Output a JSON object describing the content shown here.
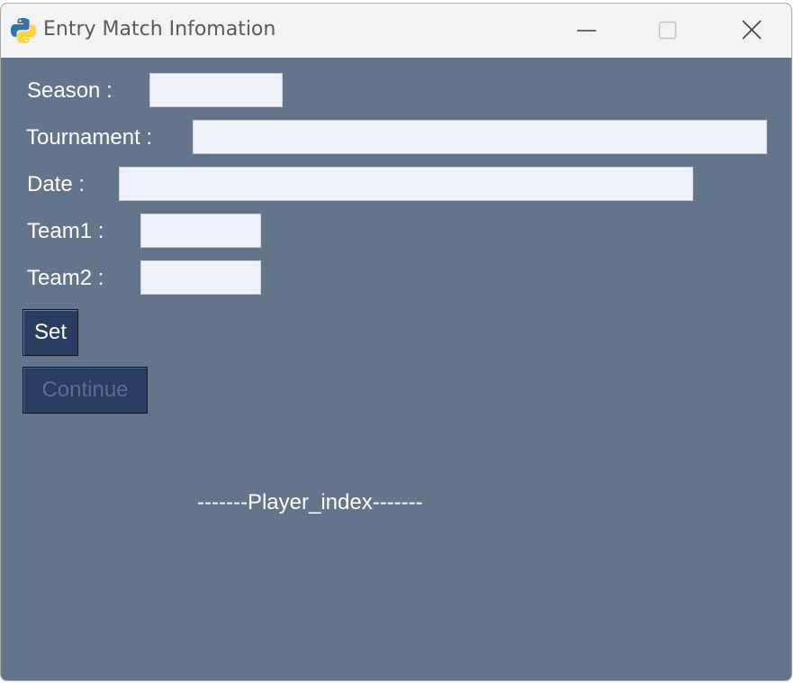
{
  "window": {
    "title": "Entry Match Infomation",
    "controls": {
      "minimize": "minimize-icon",
      "maximize": "maximize-icon",
      "close": "close-icon"
    }
  },
  "form": {
    "season_label": "Season :",
    "season_value": "",
    "tournament_label": "Tournament :",
    "tournament_value": "",
    "date_label": "Date :",
    "date_value": "",
    "team1_label": "Team1 :",
    "team1_value": "",
    "team2_label": "Team2 :",
    "team2_value": ""
  },
  "buttons": {
    "set_label": "Set",
    "continue_label": "Continue"
  },
  "player_index_text": "-------Player_index-------",
  "colors": {
    "background": "#64758b",
    "titlebar": "#f3f3f3",
    "entry_bg": "#eff2f8",
    "button_bg": "#293c61",
    "button_text": "#ffffff",
    "button_disabled_text": "#5c6e8c"
  }
}
